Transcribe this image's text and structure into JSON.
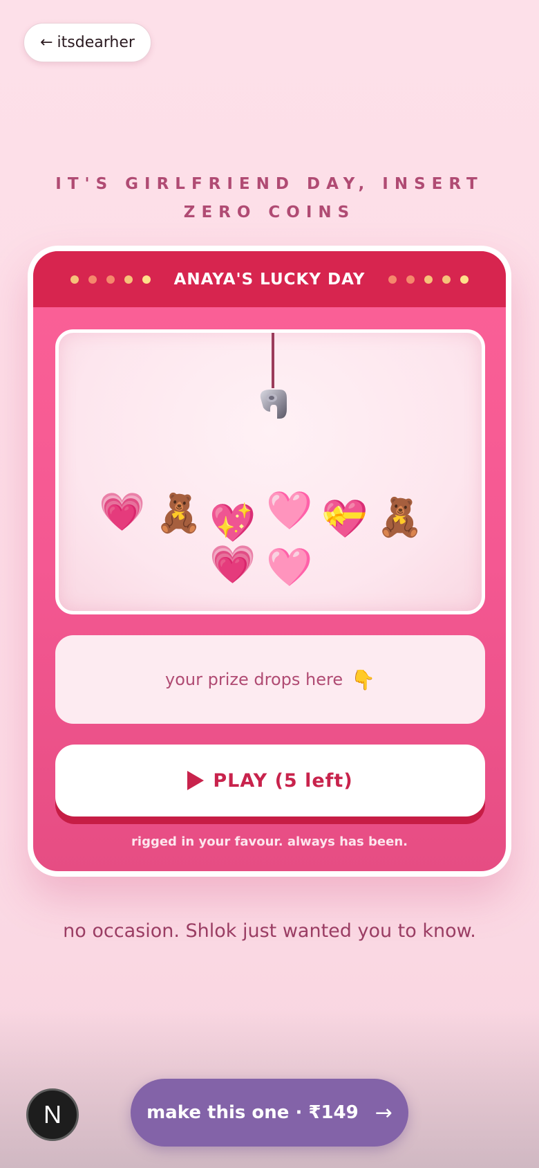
{
  "back_button": {
    "label": "itsdearher",
    "icon": "arrow-left-icon"
  },
  "headline": "IT'S GIRLFRIEND DAY, INSERT ZERO COINS",
  "machine": {
    "title": "ANAYA'S LUCKY DAY",
    "left_dots": [
      "#f6c27a",
      "#f5886c",
      "#f5886c",
      "#f6c27a",
      "#ffe08a"
    ],
    "right_dots": [
      "#f5886c",
      "#f5886c",
      "#f6c27a",
      "#f6c27a",
      "#ffe08a"
    ],
    "prizes": [
      {
        "emoji": "💗",
        "name": "glowing-heart"
      },
      {
        "emoji": "🧸",
        "name": "teddy-bear"
      },
      {
        "emoji": "💖",
        "name": "sparkling-heart"
      },
      {
        "emoji": "🩷",
        "name": "pink-heart"
      },
      {
        "emoji": "💝",
        "name": "heart-with-ribbon"
      },
      {
        "emoji": "🧸",
        "name": "teddy-bear"
      },
      {
        "emoji": "💗",
        "name": "glowing-heart"
      },
      {
        "emoji": "🩷",
        "name": "pink-heart"
      }
    ],
    "slot_text": "your prize drops here",
    "slot_emoji": "👇",
    "play_label": "PLAY (5 left)",
    "fine_print": "rigged in your favour. always has been."
  },
  "tagline": "no occasion. Shlok just wanted you to know.",
  "n_badge": "N",
  "cta": {
    "label": "make this one · ₹149",
    "icon": "arrow-right-icon"
  }
}
